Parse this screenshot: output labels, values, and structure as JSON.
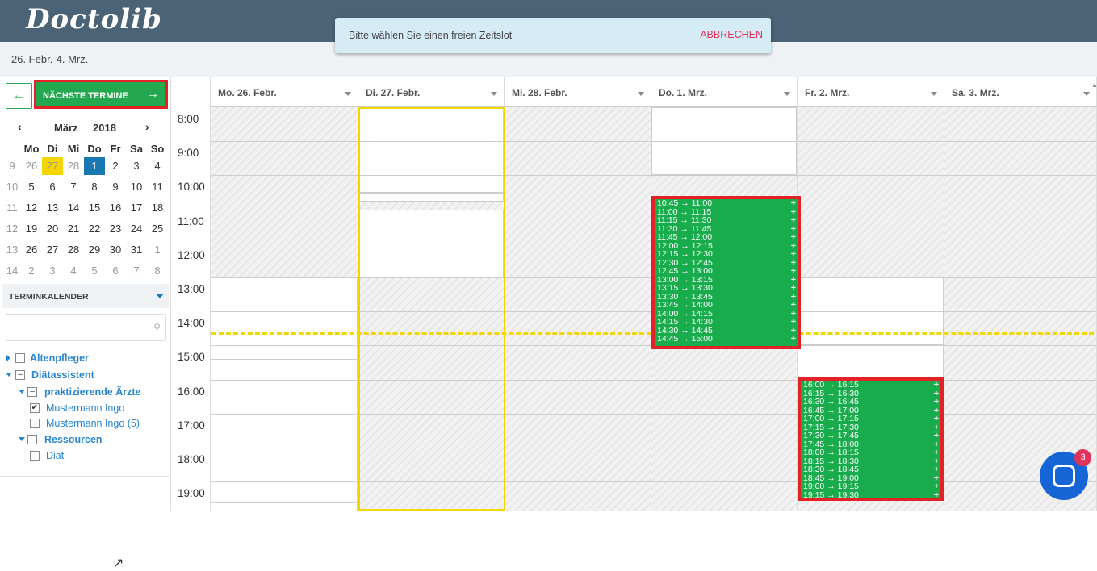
{
  "app": {
    "logo": "Doctolib"
  },
  "header": {
    "date_range": "26. Febr.-4. Mrz."
  },
  "toast": {
    "message": "Bitte wählen Sie einen freien Zeitslot",
    "cancel_label": "ABBRECHEN"
  },
  "sidebar": {
    "back_icon": "←",
    "next_label": "NÄCHSTE TERMINE",
    "next_icon": "→",
    "calendar": {
      "prev": "‹",
      "next": "›",
      "month": "März",
      "year": "2018",
      "weekdays": [
        "Mo",
        "Di",
        "Mi",
        "Do",
        "Fr",
        "Sa",
        "So"
      ],
      "weeks": [
        {
          "num": "9",
          "days": [
            "26",
            "27",
            "28",
            "1",
            "2",
            "3",
            "4"
          ]
        },
        {
          "num": "10",
          "days": [
            "5",
            "6",
            "7",
            "8",
            "9",
            "10",
            "11"
          ]
        },
        {
          "num": "11",
          "days": [
            "12",
            "13",
            "14",
            "15",
            "16",
            "17",
            "18"
          ]
        },
        {
          "num": "12",
          "days": [
            "19",
            "20",
            "21",
            "22",
            "23",
            "24",
            "25"
          ]
        },
        {
          "num": "13",
          "days": [
            "26",
            "27",
            "28",
            "29",
            "30",
            "31",
            "1"
          ]
        },
        {
          "num": "14",
          "days": [
            "2",
            "3",
            "4",
            "5",
            "6",
            "7",
            "8"
          ]
        }
      ]
    },
    "terminkalender": {
      "title": "TERMINKALENDER",
      "search_placeholder": "",
      "tree": {
        "altenpfleger": "Altenpfleger",
        "diaetassistent": "Diätassistent",
        "praktizierende": "praktizierende Ärzte",
        "mustermann1": "Mustermann Ingo",
        "mustermann2": "Mustermann Ingo (5)",
        "ressourcen": "Ressourcen",
        "diaet": "Diät"
      }
    }
  },
  "calendar": {
    "times": [
      "8:00",
      "9:00",
      "10:00",
      "11:00",
      "12:00",
      "13:00",
      "14:00",
      "15:00",
      "16:00",
      "17:00",
      "18:00",
      "19:00"
    ],
    "days": [
      "Mo. 26. Febr.",
      "Di. 27. Febr.",
      "Mi. 28. Febr.",
      "Do. 1. Mrz.",
      "Fr. 2. Mrz.",
      "Sa. 3. Mrz."
    ],
    "thursday_slots": [
      "10:45 → 11:00",
      "11:00 → 11:15",
      "11:15 → 11:30",
      "11:30 → 11:45",
      "11:45 → 12:00",
      "12:00 → 12:15",
      "12:15 → 12:30",
      "12:30 → 12:45",
      "12:45 → 13:00",
      "13:00 → 13:15",
      "13:15 → 13:30",
      "13:30 → 13:45",
      "13:45 → 14:00",
      "14:00 → 14:15",
      "14:15 → 14:30",
      "14:30 → 14:45",
      "14:45 → 15:00"
    ],
    "friday_slots": [
      "16:00 → 16:15",
      "16:15 → 16:30",
      "16:30 → 16:45",
      "16:45 → 17:00",
      "17:00 → 17:15",
      "17:15 → 17:30",
      "17:30 → 17:45",
      "17:45 → 18:00",
      "18:00 → 18:15",
      "18:15 → 18:30",
      "18:30 → 18:45",
      "18:45 → 19:00",
      "19:00 → 19:15",
      "19:15 → 19:30"
    ],
    "slot_plus": "+"
  },
  "chat": {
    "badge": "3"
  }
}
